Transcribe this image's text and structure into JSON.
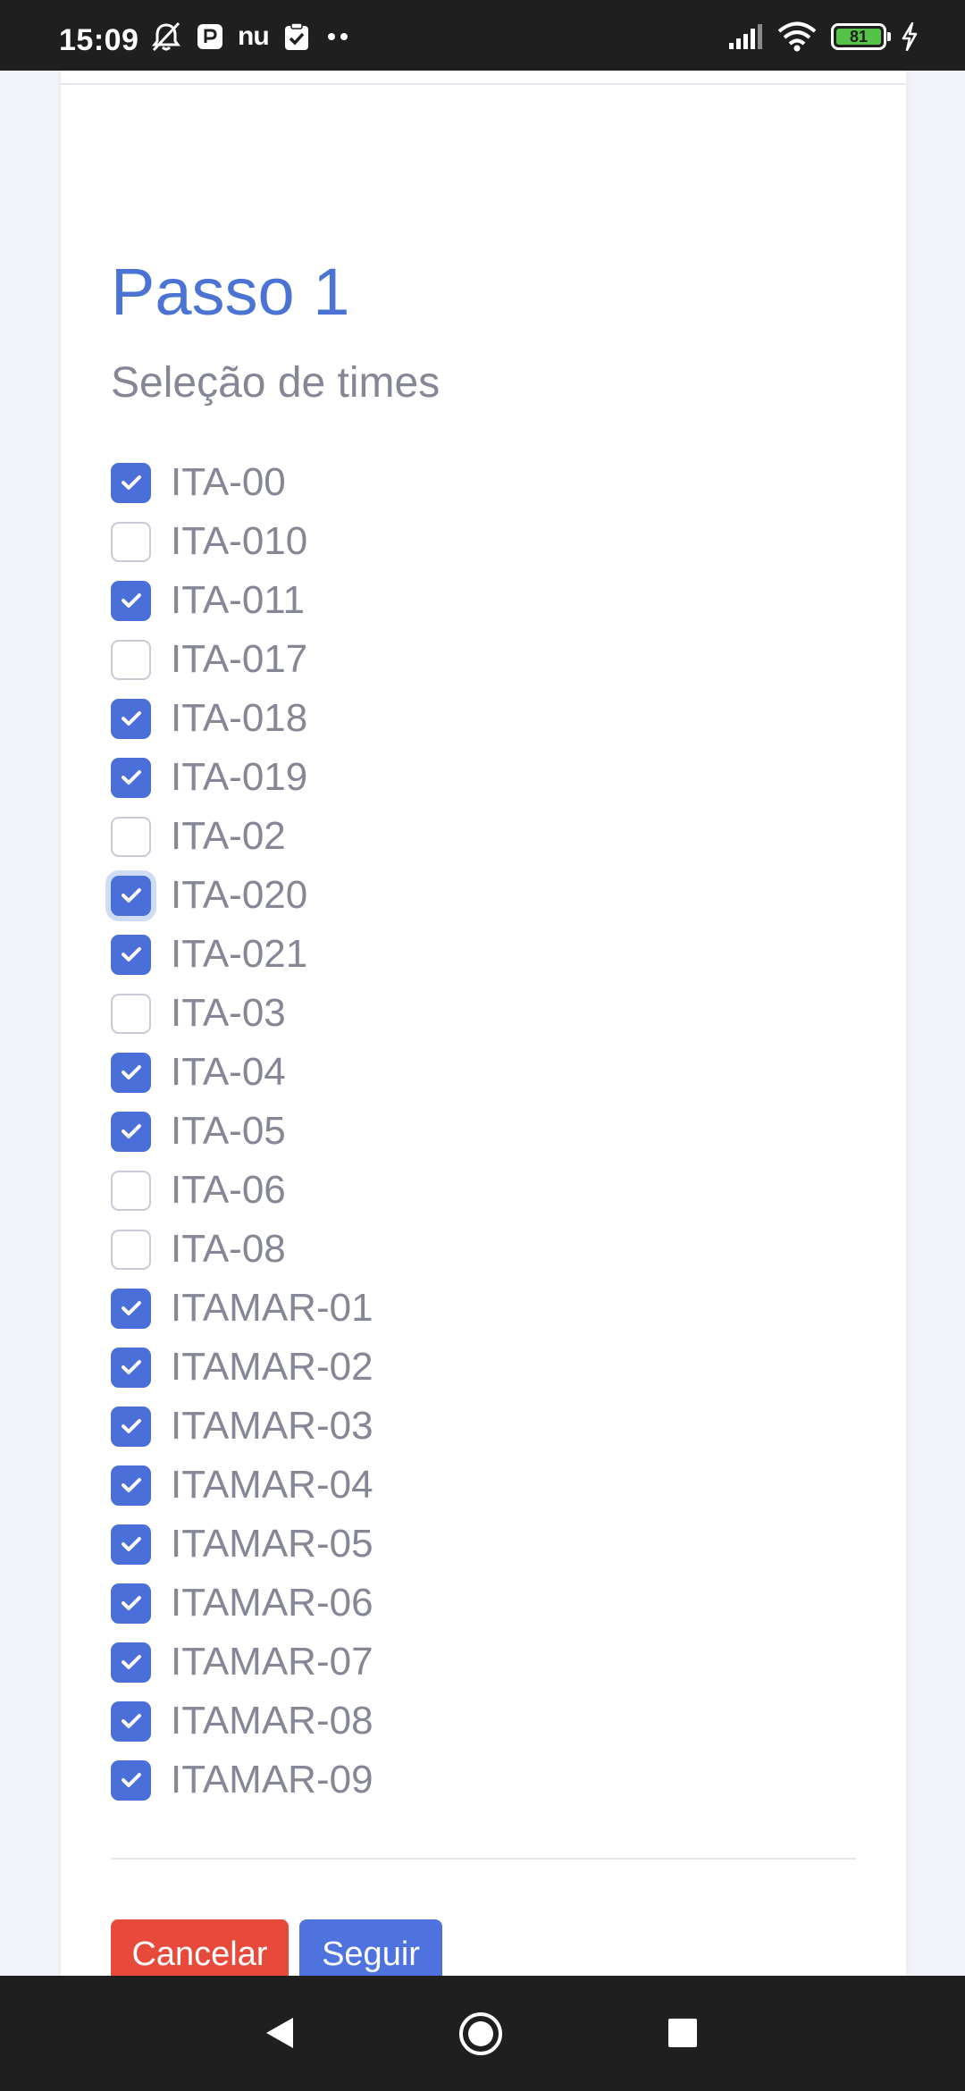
{
  "status_bar": {
    "time": "15:09",
    "nu_label": "nu",
    "battery_level": "81",
    "icons": [
      "silent-bell-icon",
      "parking-app-icon",
      "nubank-icon",
      "clipboard-check-icon",
      "more-dots-icon",
      "signal-icon",
      "wifi-icon",
      "battery-icon",
      "charging-icon"
    ]
  },
  "page": {
    "step_title": "Passo 1",
    "step_subtitle": "Seleção de times"
  },
  "teams": [
    {
      "label": "ITA-00",
      "checked": true
    },
    {
      "label": "ITA-010",
      "checked": false
    },
    {
      "label": "ITA-011",
      "checked": true
    },
    {
      "label": "ITA-017",
      "checked": false
    },
    {
      "label": "ITA-018",
      "checked": true
    },
    {
      "label": "ITA-019",
      "checked": true
    },
    {
      "label": "ITA-02",
      "checked": false
    },
    {
      "label": "ITA-020",
      "checked": true,
      "focused": true
    },
    {
      "label": "ITA-021",
      "checked": true
    },
    {
      "label": "ITA-03",
      "checked": false
    },
    {
      "label": "ITA-04",
      "checked": true
    },
    {
      "label": "ITA-05",
      "checked": true
    },
    {
      "label": "ITA-06",
      "checked": false
    },
    {
      "label": "ITA-08",
      "checked": false
    },
    {
      "label": "ITAMAR-01",
      "checked": true
    },
    {
      "label": "ITAMAR-02",
      "checked": true
    },
    {
      "label": "ITAMAR-03",
      "checked": true
    },
    {
      "label": "ITAMAR-04",
      "checked": true
    },
    {
      "label": "ITAMAR-05",
      "checked": true
    },
    {
      "label": "ITAMAR-06",
      "checked": true
    },
    {
      "label": "ITAMAR-07",
      "checked": true
    },
    {
      "label": "ITAMAR-08",
      "checked": true
    },
    {
      "label": "ITAMAR-09",
      "checked": true
    }
  ],
  "actions": {
    "cancel_label": "Cancelar",
    "next_label": "Seguir"
  },
  "colors": {
    "primary": "#4e73df",
    "danger": "#e74a3b",
    "text_muted": "#858796",
    "title": "#4a73d4"
  },
  "nav_bar": {
    "icons": [
      "back-icon",
      "home-icon",
      "recents-icon"
    ]
  }
}
